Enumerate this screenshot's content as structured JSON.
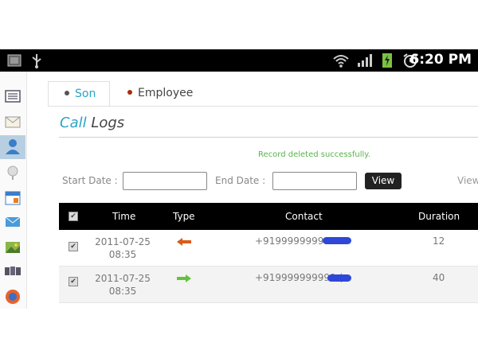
{
  "status_bar": {
    "time": "6:20 PM",
    "icons": [
      "gallery-icon",
      "usb-icon",
      "wifi-icon",
      "signal-icon",
      "battery-charging-icon",
      "alarm-icon"
    ]
  },
  "sidebar": {
    "items": [
      "list-icon",
      "mail-icon",
      "contacts-icon",
      "location-icon",
      "calendar-icon",
      "message-icon",
      "gallery-icon",
      "files-icon",
      "browser-icon"
    ],
    "active_index": 2
  },
  "tabs": [
    {
      "label": "Son",
      "active": true,
      "dot_color": "#555555"
    },
    {
      "label": "Employee",
      "active": false,
      "dot_color": "#a5300a"
    }
  ],
  "page": {
    "title_accent": "Call",
    "title_rest": " Logs"
  },
  "message": "Record deleted successfully.",
  "filters": {
    "start_label": "Start Date :",
    "start_value": "",
    "end_label": "End Date :",
    "end_value": "",
    "view_button": "View",
    "view_link": "View"
  },
  "table": {
    "headers": [
      "Time",
      "Type",
      "Contact",
      "Duration"
    ],
    "rows": [
      {
        "date": "2011-07-25",
        "time": "08:35",
        "type": "outgoing",
        "contact": "+919999999999",
        "duration": "12"
      },
      {
        "date": "2011-07-25",
        "time": "08:35",
        "type": "incoming",
        "contact": "+919999999999 (",
        "duration": "40"
      }
    ]
  },
  "colors": {
    "accent": "#2aa3c8",
    "success": "#58b34d",
    "outgoing": "#d95a1a",
    "incoming": "#63c23a",
    "redaction": "#2e47d9"
  }
}
